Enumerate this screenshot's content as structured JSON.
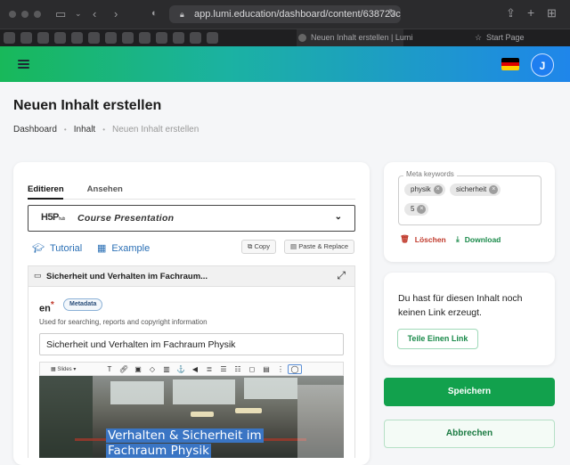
{
  "browser": {
    "url": "app.lumi.education/dashboard/content/638723c0",
    "tabs": [
      {
        "label": "Neuen Inhalt erstellen | Lumi"
      },
      {
        "label": "Start Page"
      }
    ]
  },
  "header": {
    "avatar_initial": "J",
    "language_flag": "german-flag",
    "flag_colors": [
      "#000000",
      "#dd0000",
      "#ffce00"
    ]
  },
  "page": {
    "title": "Neuen Inhalt erstellen",
    "breadcrumbs": [
      "Dashboard",
      "Inhalt",
      "Neuen Inhalt erstellen"
    ]
  },
  "editor": {
    "tabs": [
      "Editieren",
      "Ansehen"
    ],
    "content_type_logo": "H5P",
    "content_type_logo_sub": "hub",
    "content_type": "Course Presentation",
    "tutorial_label": "Tutorial",
    "example_label": "Example",
    "copy_label": "Copy",
    "paste_label": "Paste & Replace",
    "section_title": "Sicherheit und Verhalten im Fachraum...",
    "language_code": "en",
    "required_mark": "*",
    "metadata_label": "Metadata",
    "hint": "Used for searching, reports and copyright information",
    "title_value": "Sicherheit und Verhalten im Fachraum Physik",
    "toolbar_slides": "Slides",
    "slide_text_line1": "Verhalten & Sicherheit im",
    "slide_text_line2": "Fachraum Physik"
  },
  "sidebar": {
    "keywords_label": "Meta keywords",
    "keywords": [
      "physik",
      "sicherheit",
      "5"
    ],
    "delete_label": "Löschen",
    "download_label": "Download",
    "link_text": "Du hast für diesen Inhalt noch keinen Link erzeugt.",
    "share_label": "Teile Einen Link",
    "save_label": "Speichern",
    "cancel_label": "Abbrechen"
  },
  "colors": {
    "primary_green": "#12a14d",
    "accent_blue": "#1e7ef0",
    "delete_red": "#c0392b"
  }
}
